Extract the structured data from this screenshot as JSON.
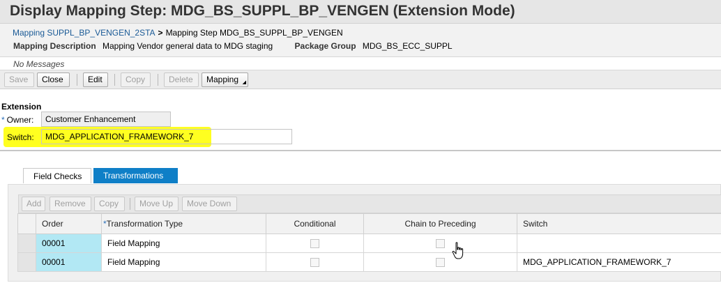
{
  "title": "Display Mapping Step: MDG_BS_SUPPL_BP_VENGEN (Extension Mode)",
  "breadcrumb": {
    "link": "Mapping SUPPL_BP_VENGEN_2STA",
    "separator": ">",
    "current": "Mapping Step MDG_BS_SUPPL_BP_VENGEN"
  },
  "header": {
    "mapping_description_label": "Mapping Description",
    "mapping_description_value": "Mapping Vendor general data to MDG staging",
    "package_group_label": "Package Group",
    "package_group_value": "MDG_BS_ECC_SUPPL"
  },
  "messages": "No Messages",
  "toolbar": {
    "save": "Save",
    "close": "Close",
    "edit": "Edit",
    "copy": "Copy",
    "delete": "Delete",
    "mapping": "Mapping"
  },
  "extension": {
    "section_title": "Extension",
    "required_marker": "*",
    "owner_label": "Owner:",
    "owner_value": "Customer Enhancement",
    "switch_label": "Switch:",
    "switch_value": "MDG_APPLICATION_FRAMEWORK_7"
  },
  "tabs": {
    "field_checks": "Field Checks",
    "transformations": "Transformations"
  },
  "table_toolbar": {
    "add": "Add",
    "remove": "Remove",
    "copy": "Copy",
    "move_up": "Move Up",
    "move_down": "Move Down"
  },
  "table": {
    "columns": {
      "order": "Order",
      "transformation_type_marker": "*",
      "transformation_type": "Transformation Type",
      "conditional": "Conditional",
      "chain_to_preceding": "Chain to Preceding",
      "switch": "Switch"
    },
    "rows": [
      {
        "order": "00001",
        "transformation_type": "Field Mapping",
        "conditional": false,
        "chain_to_preceding": false,
        "switch": ""
      },
      {
        "order": "00001",
        "transformation_type": "Field Mapping",
        "conditional": false,
        "chain_to_preceding": false,
        "switch": "MDG_APPLICATION_FRAMEWORK_7"
      }
    ]
  },
  "colors": {
    "accent_tab": "#0f7fc7",
    "highlight": "#ffff20",
    "key_cell": "#b2e8f4",
    "link": "#1a5a96"
  },
  "icons": {
    "mapping_menu": "dropdown-triangle-icon",
    "cursor": "hand-pointer-icon"
  }
}
